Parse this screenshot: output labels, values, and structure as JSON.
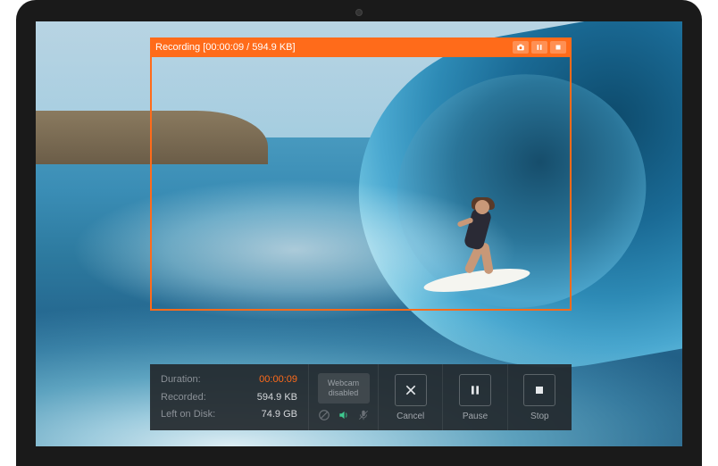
{
  "colors": {
    "accent": "#ff6b1a"
  },
  "capture": {
    "status_prefix": "Recording",
    "time": "00:00:09",
    "size": "594.9 KB",
    "full_label": "Recording [00:00:09 / 594.9 KB]",
    "mini_buttons": {
      "screenshot": "Screenshot",
      "pause": "Pause",
      "stop": "Stop"
    }
  },
  "stats": {
    "duration_label": "Duration:",
    "duration_value": "00:00:09",
    "recorded_label": "Recorded:",
    "recorded_value": "594.9 KB",
    "disk_label": "Left on Disk:",
    "disk_value": "74.9 GB"
  },
  "webcam": {
    "text": "Webcam disabled"
  },
  "audio_icons": {
    "system_sound": "system-audio-muted",
    "speaker": "speaker-on",
    "microphone": "microphone-muted"
  },
  "actions": {
    "cancel": "Cancel",
    "pause": "Pause",
    "stop": "Stop"
  }
}
